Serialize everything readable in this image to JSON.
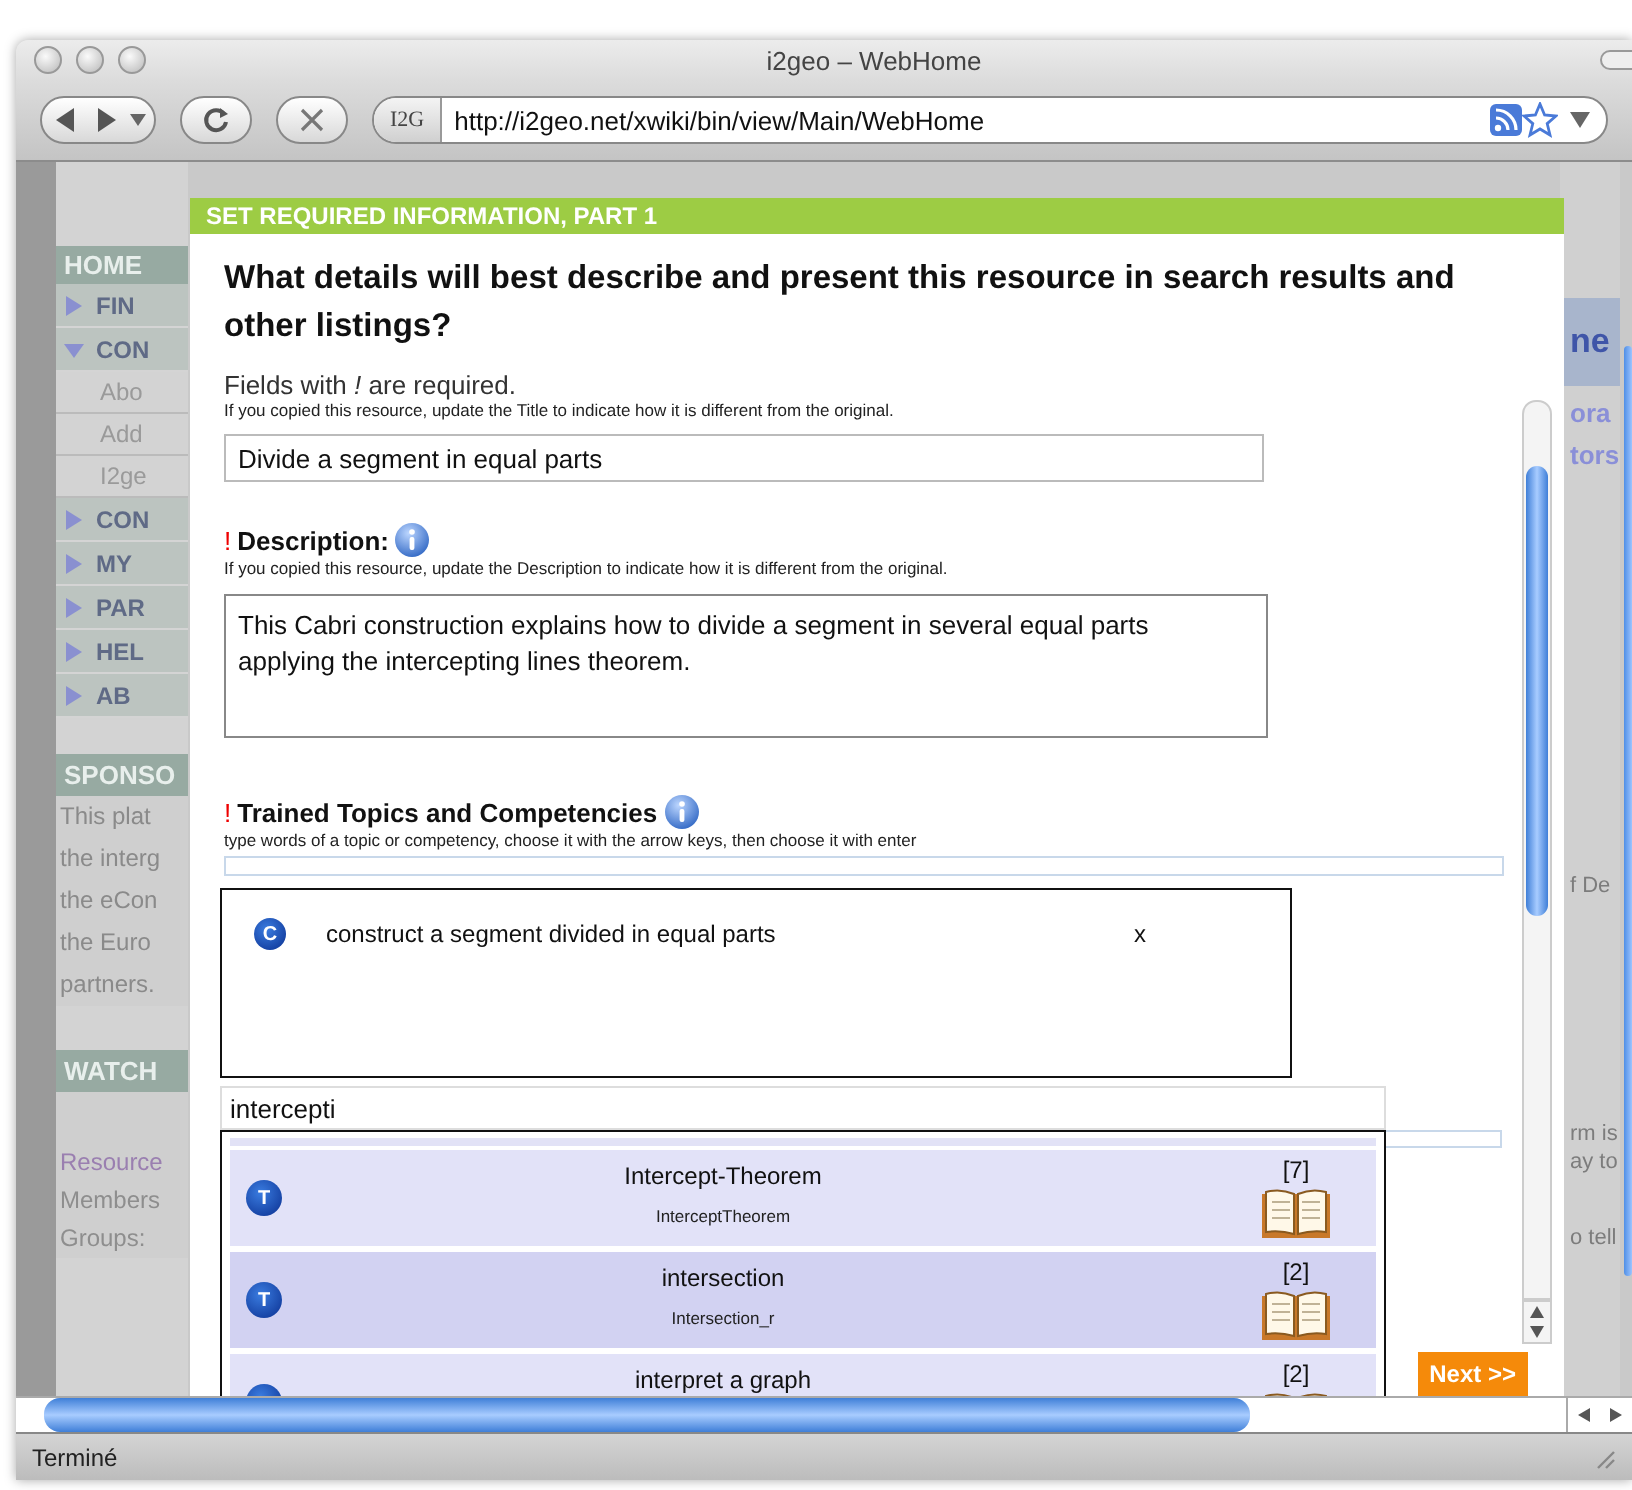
{
  "window": {
    "title": "i2geo – WebHome"
  },
  "toolbar": {
    "site_badge": "I2G",
    "url": "http://i2geo.net/xwiki/bin/view/Main/WebHome"
  },
  "background_page": {
    "sidebar": {
      "header": "HOME",
      "items": [
        {
          "label": "FIN",
          "expanded": false
        },
        {
          "label": "CON",
          "expanded": true,
          "children": [
            {
              "label": "Abo"
            },
            {
              "label": "Add"
            },
            {
              "label": "I2ge"
            }
          ]
        },
        {
          "label": "CON",
          "expanded": false
        },
        {
          "label": "MY",
          "expanded": false
        },
        {
          "label": "PAR",
          "expanded": false
        },
        {
          "label": "HEL",
          "expanded": false
        },
        {
          "label": "AB",
          "expanded": false
        }
      ]
    },
    "sponsors": {
      "header": "SPONSO",
      "lines": [
        "This plat",
        "the interg",
        "the eCon",
        "the Euro",
        "partners."
      ]
    },
    "watch": {
      "header": "WATCH",
      "lines": [
        {
          "text": "Resource",
          "kind": "link"
        },
        {
          "text": "Members",
          "kind": "plain"
        },
        {
          "text": "Groups:",
          "kind": "plain"
        }
      ]
    },
    "right_column": {
      "heading": "ne",
      "links": [
        "ora",
        "tors"
      ],
      "texts": [
        "f De",
        "rm is",
        "ay to",
        "o tell"
      ]
    }
  },
  "dialog": {
    "header": "SET REQUIRED INFORMATION, PART 1",
    "question": "What details will best describe and present this resource in search results and other listings?",
    "required_note": "Fields with *!* are required.",
    "title_field": {
      "hint": "If you copied this resource, update the Title to indicate how it is different from the original.",
      "value": "Divide a segment in equal parts"
    },
    "description": {
      "required_mark": "!",
      "label": "Description:",
      "hint": "If you copied this resource, update the Description to indicate how it is different from the original.",
      "value": "This Cabri construction explains how to divide a segment in several equal parts applying the intercepting lines theorem."
    },
    "topics": {
      "required_mark": "!",
      "label": "Trained Topics and Competencies",
      "hint": "type words of a topic or competency, choose it with the arrow keys, then choose it with enter",
      "chosen": [
        {
          "badge": "C",
          "label": "construct a segment divided in equal parts",
          "remove": "x"
        }
      ],
      "query": "intercepti",
      "suggestions": [
        {
          "badge": "T",
          "title": "Intercept-Theorem",
          "id": "InterceptTheorem",
          "count": "[7]",
          "selected": false
        },
        {
          "badge": "T",
          "title": "intersection",
          "id": "Intersection_r",
          "count": "[2]",
          "selected": true
        },
        {
          "title": "interpret a graph",
          "count": "[2]",
          "selected": false
        }
      ]
    },
    "next_button": "Next >>"
  },
  "status_bar": {
    "text": "Terminé"
  }
}
